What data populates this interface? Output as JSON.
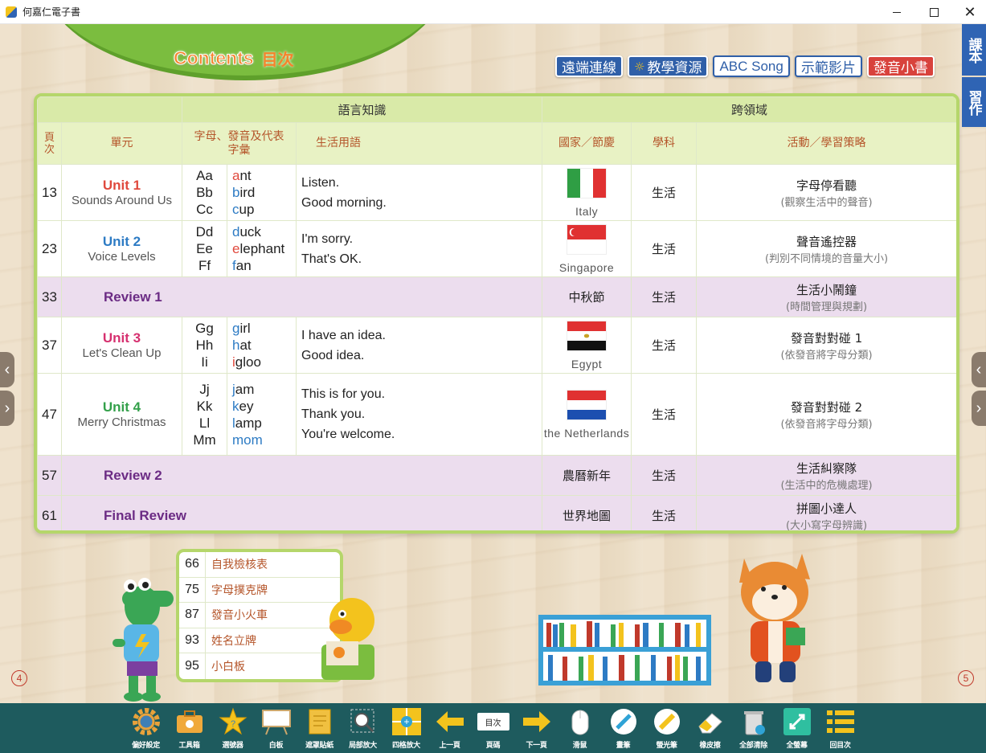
{
  "window": {
    "title": "何嘉仁電子書"
  },
  "header": {
    "contents_en": "Contents",
    "contents_zh": "目次",
    "chips": [
      {
        "label": "遠端連線",
        "style": "blue"
      },
      {
        "label": "教學資源",
        "style": "blue"
      },
      {
        "label": "ABC Song",
        "style": "white"
      },
      {
        "label": "示範影片",
        "style": "white"
      },
      {
        "label": "發音小書",
        "style": "red"
      }
    ]
  },
  "side_tabs": [
    "課本",
    "習作"
  ],
  "table": {
    "group_headers": {
      "language": "語言知識",
      "cross": "跨領域"
    },
    "columns": {
      "page": "頁次",
      "unit": "單元",
      "letters": "字母、發音及代表字彙",
      "phrases": "生活用語",
      "festival": "國家／節慶",
      "subject": "學科",
      "activity": "活動／學習策略"
    },
    "rows": [
      {
        "page": "13",
        "unit_title": "Unit 1",
        "unit_sub": "Sounds Around Us",
        "letters": [
          "Aa",
          "Bb",
          "Cc"
        ],
        "words": [
          [
            "a",
            "nt"
          ],
          [
            "b",
            "ird"
          ],
          [
            "c",
            "up"
          ]
        ],
        "phrases": [
          "Listen.",
          "Good morning."
        ],
        "country": "Italy",
        "subject": "生活",
        "activity": "字母停看聽",
        "activity_sub": "(觀察生活中的聲音)"
      },
      {
        "page": "23",
        "unit_title": "Unit 2",
        "unit_sub": "Voice Levels",
        "letters": [
          "Dd",
          "Ee",
          "Ff"
        ],
        "words": [
          [
            "d",
            "uck"
          ],
          [
            "e",
            "lephant"
          ],
          [
            "f",
            "an"
          ]
        ],
        "phrases": [
          "I'm sorry.",
          "That's OK."
        ],
        "country": "Singapore",
        "subject": "生活",
        "activity": "聲音遙控器",
        "activity_sub": "(判別不同情境的音量大小)"
      },
      {
        "page": "33",
        "review": "Review 1",
        "festival": "中秋節",
        "subject": "生活",
        "activity": "生活小鬧鐘",
        "activity_sub": "(時間管理與規劃)"
      },
      {
        "page": "37",
        "unit_title": "Unit 3",
        "unit_sub": "Let's Clean Up",
        "letters": [
          "Gg",
          "Hh",
          "Ii"
        ],
        "words": [
          [
            "g",
            "irl"
          ],
          [
            "h",
            "at"
          ],
          [
            "i",
            "gloo"
          ]
        ],
        "phrases": [
          "I have an idea.",
          "Good idea."
        ],
        "country": "Egypt",
        "subject": "生活",
        "activity": "發音對對碰 1",
        "activity_sub": "(依發音將字母分類)"
      },
      {
        "page": "47",
        "unit_title": "Unit 4",
        "unit_sub": "Merry Christmas",
        "letters": [
          "Jj",
          "Kk",
          "Ll",
          "Mm"
        ],
        "words": [
          [
            "j",
            "am"
          ],
          [
            "k",
            "ey"
          ],
          [
            "l",
            "amp"
          ],
          [
            "m",
            "om"
          ]
        ],
        "phrases": [
          "This is for you.",
          "Thank you.",
          "You're welcome."
        ],
        "country": "the Netherlands",
        "subject": "生活",
        "activity": "發音對對碰 2",
        "activity_sub": "(依發音將字母分類)"
      },
      {
        "page": "57",
        "review": "Review 2",
        "festival": "農曆新年",
        "subject": "生活",
        "activity": "生活糾察隊",
        "activity_sub": "(生活中的危機處理)"
      },
      {
        "page": "61",
        "review": "Final Review",
        "festival": "世界地圖",
        "subject": "生活",
        "activity": "拼圖小達人",
        "activity_sub": "(大小寫字母辨識)"
      }
    ]
  },
  "extras": [
    {
      "page": "66",
      "label": "自我檢核表"
    },
    {
      "page": "75",
      "label": "字母撲克牌"
    },
    {
      "page": "87",
      "label": "發音小火車"
    },
    {
      "page": "93",
      "label": "姓名立牌"
    },
    {
      "page": "95",
      "label": "小白板"
    }
  ],
  "page_numbers": {
    "left": "4",
    "right": "5"
  },
  "colors": {
    "toolbar": "#1e5b5e",
    "accent_green": "#b5d66b",
    "side_tab": "#2f64b4",
    "review_row": "#ecddee"
  },
  "toolbar": [
    {
      "label": "偏好設定",
      "icon": "gear-icon"
    },
    {
      "label": "工具箱",
      "icon": "toolbox-icon"
    },
    {
      "label": "選號器",
      "icon": "star-icon"
    },
    {
      "label": "白板",
      "icon": "whiteboard-icon"
    },
    {
      "label": "遮罩貼紙",
      "icon": "sticky-note-icon"
    },
    {
      "label": "局部放大",
      "icon": "magnifier-icon"
    },
    {
      "label": "四格放大",
      "icon": "quad-zoom-icon"
    },
    {
      "label": "上一頁",
      "icon": "arrow-left-icon"
    },
    {
      "label": "頁碼",
      "icon": "page-number-icon",
      "badge": "目次"
    },
    {
      "label": "下一頁",
      "icon": "arrow-right-icon"
    },
    {
      "label": "滑鼠",
      "icon": "mouse-icon"
    },
    {
      "label": "畫筆",
      "icon": "pen-icon"
    },
    {
      "label": "螢光筆",
      "icon": "highlighter-icon"
    },
    {
      "label": "橡皮擦",
      "icon": "eraser-icon"
    },
    {
      "label": "全部清除",
      "icon": "trash-icon"
    },
    {
      "label": "全螢幕",
      "icon": "fullscreen-icon"
    },
    {
      "label": "回目次",
      "icon": "list-icon"
    }
  ]
}
